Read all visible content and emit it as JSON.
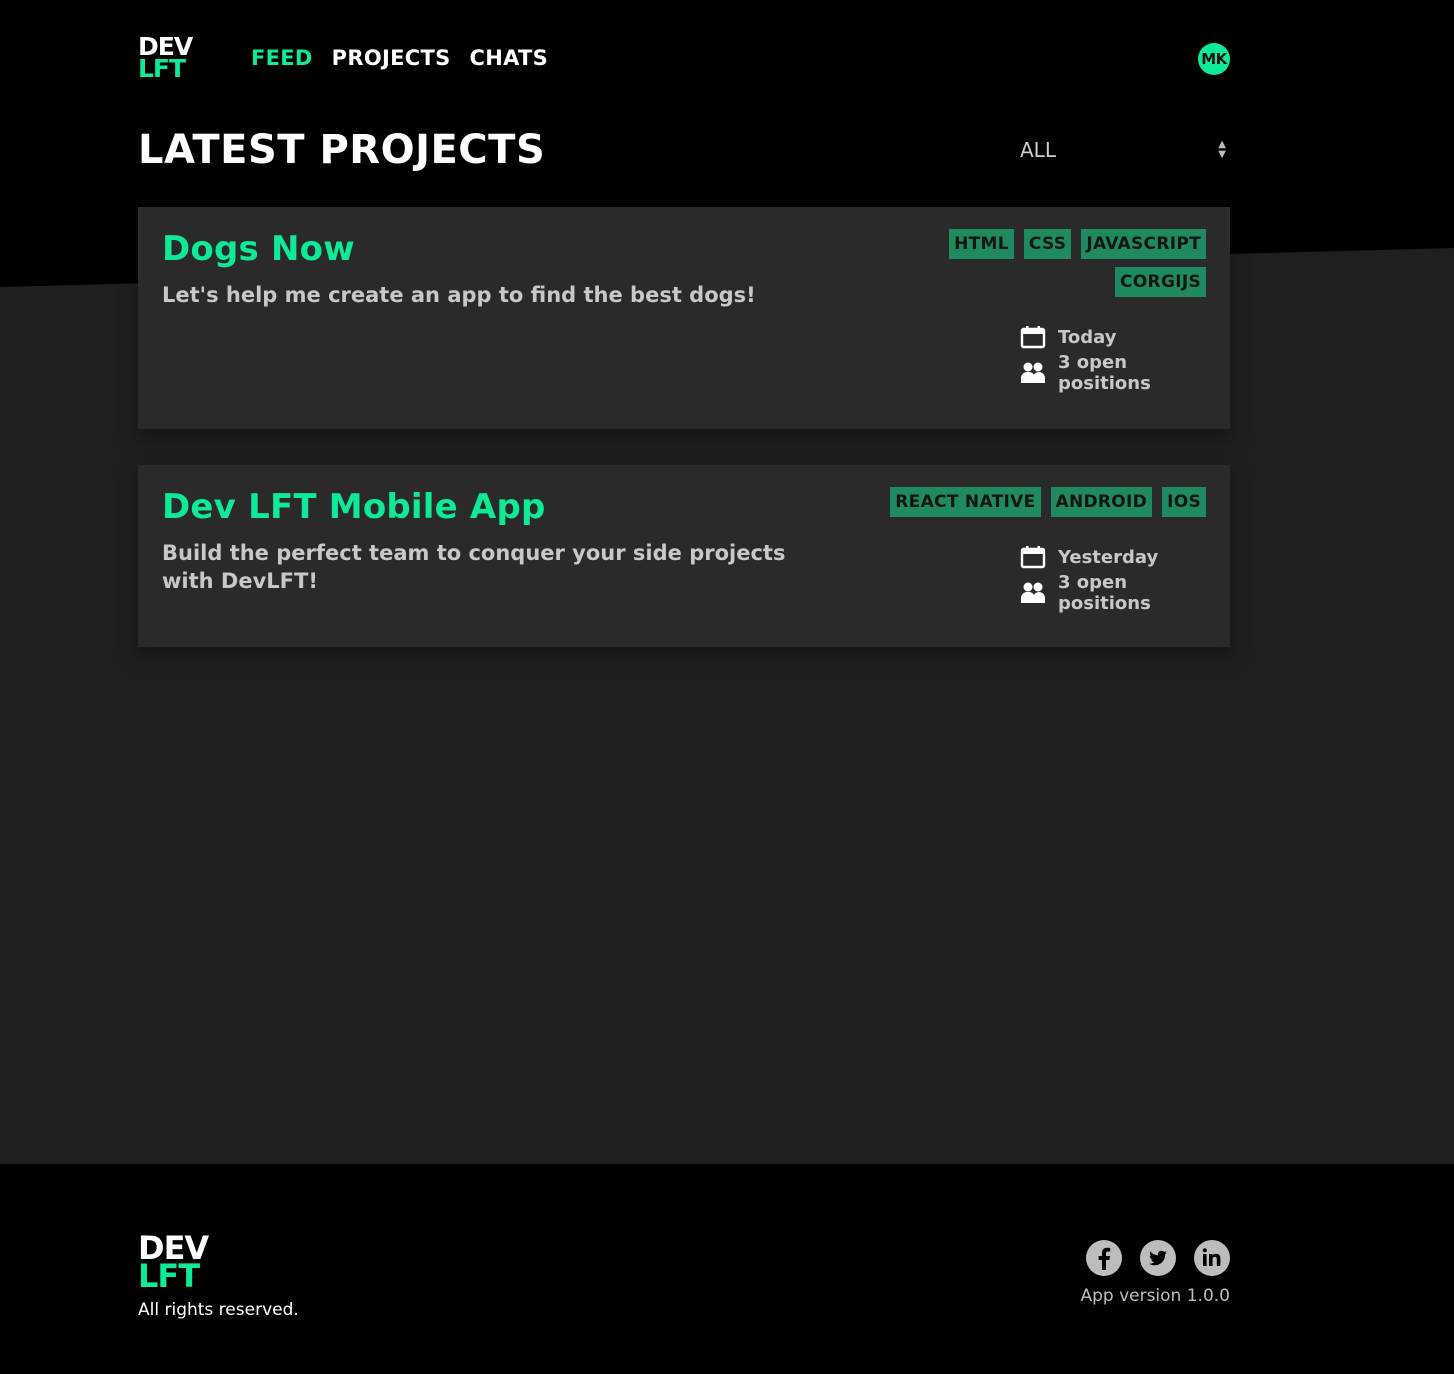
{
  "brand": {
    "logo_top": "DEV",
    "logo_bottom": "LFT",
    "accent_color": "#0eea95",
    "tag_color": "#1e8a5e"
  },
  "nav": {
    "items": [
      {
        "label": "FEED",
        "active": true
      },
      {
        "label": "PROJECTS",
        "active": false
      },
      {
        "label": "CHATS",
        "active": false
      }
    ]
  },
  "user": {
    "initials": "MK"
  },
  "page": {
    "title": "LATEST PROJECTS"
  },
  "filter": {
    "selected": "ALL"
  },
  "projects": [
    {
      "title": "Dogs Now",
      "description": "Let's help me create an app to find the best dogs!",
      "tags": [
        "HTML",
        "CSS",
        "JAVASCRIPT",
        "CORGIJS"
      ],
      "date": "Today",
      "positions": "3 open positions"
    },
    {
      "title": "Dev LFT Mobile App",
      "description": "Build the perfect team to conquer your side projects with DevLFT!",
      "tags": [
        "REACT NATIVE",
        "ANDROID",
        "IOS"
      ],
      "date": "Yesterday",
      "positions": "3 open positions"
    }
  ],
  "footer": {
    "logo_top": "DEV",
    "logo_bottom": "LFT",
    "rights": "All rights reserved.",
    "socials": [
      {
        "name": "facebook",
        "glyph": "f"
      },
      {
        "name": "twitter",
        "glyph": "t"
      },
      {
        "name": "linkedin",
        "glyph": "in"
      }
    ],
    "version": "App version 1.0.0"
  }
}
